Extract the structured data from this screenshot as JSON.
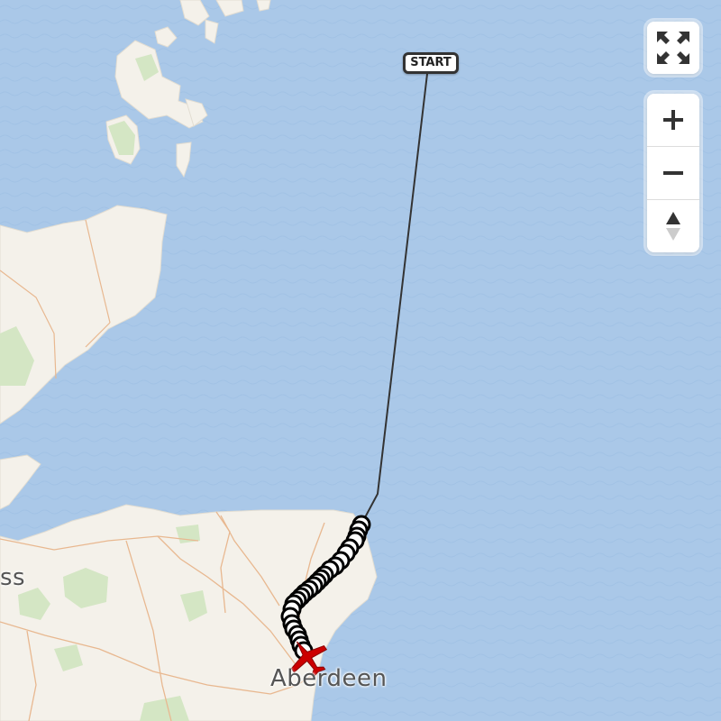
{
  "map": {
    "place_labels": [
      {
        "id": "aberdeen",
        "text": "Aberdeen"
      },
      {
        "id": "inverness-partial",
        "text": "ss"
      }
    ],
    "track": {
      "start_label": "START",
      "line_color": "#333333",
      "marker_color": "#000000",
      "aircraft_color": "#cc0000"
    },
    "colors": {
      "sea": "#aac8e8",
      "land": "#f4f1ea",
      "forest": "#d4e6c4",
      "roads": "#e8b890"
    }
  },
  "controls": {
    "fullscreen": {
      "icon": "fullscreen-icon"
    },
    "zoom_in": {
      "icon": "plus-icon"
    },
    "zoom_out": {
      "icon": "minus-icon"
    },
    "compass": {
      "icon": "compass-icon"
    }
  }
}
